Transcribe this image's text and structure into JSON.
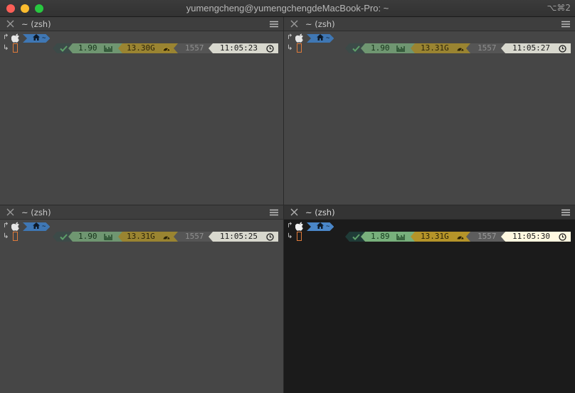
{
  "window": {
    "title": "yumengcheng@yumengchengdeMacBook-Pro: ~",
    "shortcut": "⌥⌘2"
  },
  "colors": {
    "inactive_pane_bg": "#464646",
    "active_pane_bg": "#1b1b1b",
    "dir_segment": "#4a86c8",
    "load_segment": "#78b07c",
    "ram_segment": "#b59429",
    "time_segment": "#fff8e0",
    "cursor": "#e07b3a"
  },
  "panes": {
    "top_left": {
      "title": "~ (zsh)",
      "active": false,
      "dir": "~",
      "load": "1.90",
      "ram": "13.30G",
      "history": "1557",
      "time": "11:05:23"
    },
    "top_right": {
      "title": "~ (zsh)",
      "active": false,
      "dir": "~",
      "load": "1.90",
      "ram": "13.31G",
      "history": "1557",
      "time": "11:05:27"
    },
    "bottom_left": {
      "title": "~ (zsh)",
      "active": false,
      "dir": "~",
      "load": "1.90",
      "ram": "13.31G",
      "history": "1557",
      "time": "11:05:25"
    },
    "bottom_right": {
      "title": "~ (zsh)",
      "active": true,
      "dir": "~",
      "load": "1.89",
      "ram": "13.31G",
      "history": "1557",
      "time": "11:05:30"
    }
  },
  "icons": {
    "line1_prefix": "↱",
    "line2_prefix": "↳",
    "status": "check-icon",
    "load": "bar-chart-icon",
    "ram": "speedometer-icon",
    "time": "clock-icon",
    "os": "apple-icon",
    "dir": "home-icon"
  }
}
